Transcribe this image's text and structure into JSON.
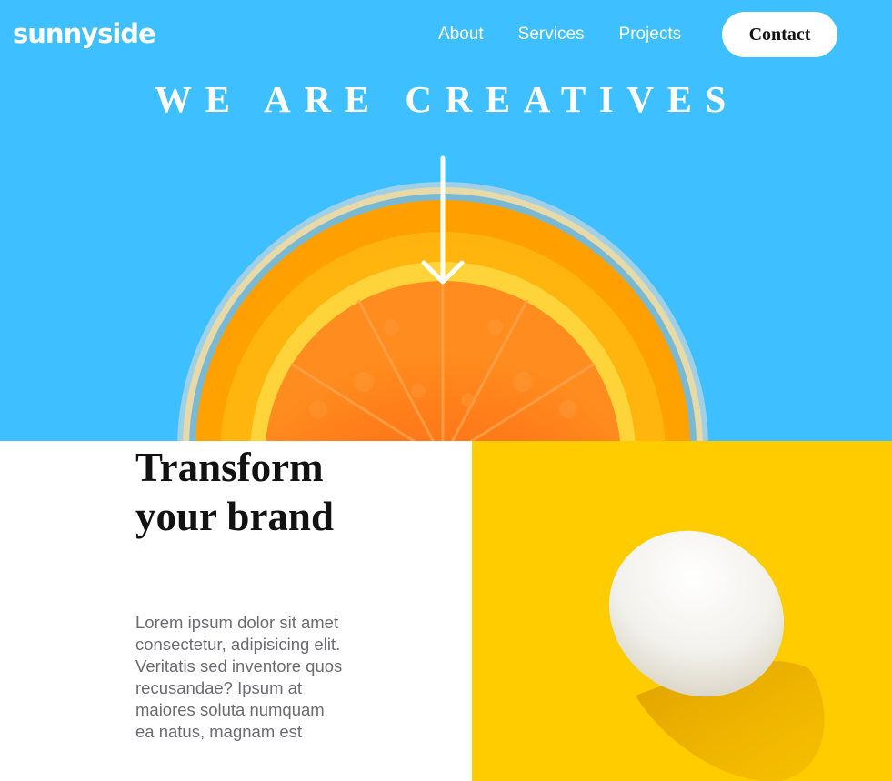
{
  "header": {
    "logo": "sunnyside",
    "nav": {
      "about": "About",
      "services": "Services",
      "projects": "Projects"
    },
    "contact_label": "Contact"
  },
  "hero": {
    "title": "WE ARE CREATIVES",
    "background_color": "#3ebfff",
    "image_subject": "orange-juice-glass",
    "arrow_icon": "arrow-down-icon"
  },
  "feature": {
    "heading": "Transform your brand",
    "body": "Lorem ipsum dolor sit amet consectetur, adipisicing elit. Veritatis sed inventore quos recusandae? Ipsum at maiores soluta numquam ea natus, magnam est",
    "image_subject": "egg-on-yellow",
    "image_background": "#ffcc00"
  }
}
